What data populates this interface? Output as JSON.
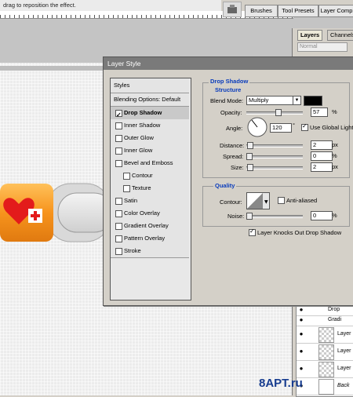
{
  "options_bar": {
    "hint": "drag to reposition the effect."
  },
  "palette_tabs": [
    "Brushes",
    "Tool Presets",
    "Layer Comp"
  ],
  "layers_panel": {
    "tabs": [
      "Layers",
      "Channels"
    ],
    "blend_mode": "Normal",
    "rows": [
      "Drop",
      "Gradi",
      "Layer",
      "Layer",
      "Layer",
      "Back"
    ]
  },
  "dialog": {
    "title": "Layer Style",
    "styles_header": "Styles",
    "blending_options": "Blending Options: Default",
    "styles": [
      {
        "label": "Drop Shadow",
        "checked": true,
        "selected": true,
        "indent": false
      },
      {
        "label": "Inner Shadow",
        "checked": false,
        "selected": false,
        "indent": false
      },
      {
        "label": "Outer Glow",
        "checked": false,
        "selected": false,
        "indent": false
      },
      {
        "label": "Inner Glow",
        "checked": false,
        "selected": false,
        "indent": false
      },
      {
        "label": "Bevel and Emboss",
        "checked": false,
        "selected": false,
        "indent": false
      },
      {
        "label": "Contour",
        "checked": false,
        "selected": false,
        "indent": true
      },
      {
        "label": "Texture",
        "checked": false,
        "selected": false,
        "indent": true
      },
      {
        "label": "Satin",
        "checked": false,
        "selected": false,
        "indent": false
      },
      {
        "label": "Color Overlay",
        "checked": false,
        "selected": false,
        "indent": false
      },
      {
        "label": "Gradient Overlay",
        "checked": false,
        "selected": false,
        "indent": false
      },
      {
        "label": "Pattern Overlay",
        "checked": false,
        "selected": false,
        "indent": false
      },
      {
        "label": "Stroke",
        "checked": false,
        "selected": false,
        "indent": false
      }
    ],
    "drop_shadow": {
      "section": "Drop Shadow",
      "structure": "Structure",
      "blend_mode_label": "Blend Mode:",
      "blend_mode": "Multiply",
      "shadow_color": "#000000",
      "opacity_label": "Opacity:",
      "opacity": "57",
      "opacity_unit": "%",
      "angle_label": "Angle:",
      "angle": "120",
      "angle_unit": "°",
      "use_global_light": "Use Global Light",
      "distance_label": "Distance:",
      "distance": "2",
      "spread_label": "Spread:",
      "spread": "0",
      "size_label": "Size:",
      "size": "2",
      "px": "px",
      "percent": "%",
      "quality": "Quality",
      "contour_label": "Contour:",
      "anti_aliased": "Anti-aliased",
      "noise_label": "Noise:",
      "noise": "0",
      "knockout": "Layer Knocks Out Drop Shadow"
    }
  },
  "watermark": "8APT.ru",
  "colors": {
    "accent_blue": "#0a3cbc",
    "button_orange": "#f7941d",
    "heart_red": "#e31b1b"
  }
}
